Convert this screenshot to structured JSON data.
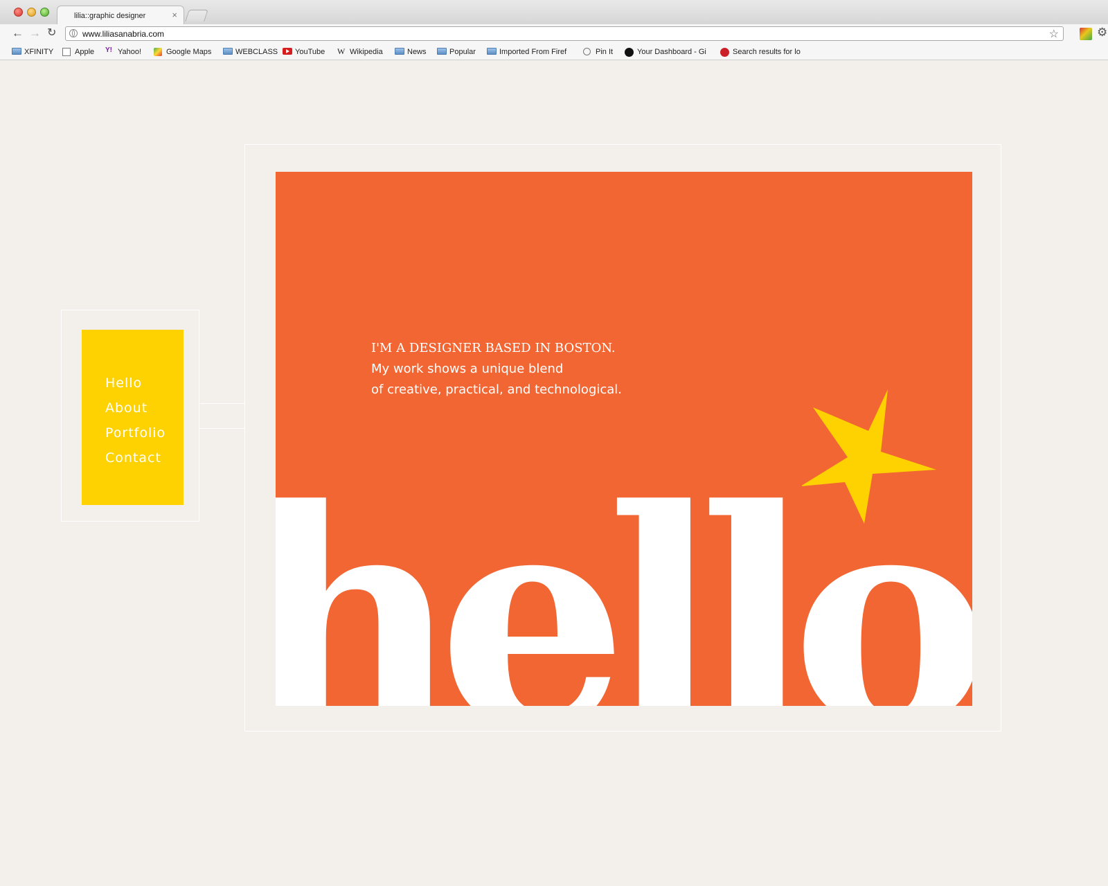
{
  "browser": {
    "tab_title": "lilia::graphic designer",
    "tab_close": "×",
    "url": "www.liliasanabria.com",
    "nav": {
      "back": "←",
      "forward": "→",
      "reload": "↻",
      "star": "☆",
      "wrench": "🔧"
    },
    "bookmarks": [
      {
        "label": "XFINITY",
        "icon": "folder-icon"
      },
      {
        "label": "Apple",
        "icon": "page-icon"
      },
      {
        "label": "Yahoo!",
        "icon": "yahoo-icon",
        "glyph": "Y!"
      },
      {
        "label": "Google Maps",
        "icon": "maps-icon"
      },
      {
        "label": "WEBCLASS",
        "icon": "folder-icon"
      },
      {
        "label": "YouTube",
        "icon": "youtube-icon"
      },
      {
        "label": "Wikipedia",
        "icon": "wikipedia-icon",
        "glyph": "W"
      },
      {
        "label": "News",
        "icon": "folder-icon"
      },
      {
        "label": "Popular",
        "icon": "folder-icon"
      },
      {
        "label": "Imported From Firef",
        "icon": "folder-icon"
      },
      {
        "label": "Pin It",
        "icon": "globe-icon"
      },
      {
        "label": "Your Dashboard - Gi",
        "icon": "github-icon"
      },
      {
        "label": "Search results for lo",
        "icon": "pinterest-icon"
      }
    ]
  },
  "site": {
    "nav": [
      "Hello",
      "About",
      "Portfolio",
      "Contact"
    ],
    "intro": [
      "I'M A  DESIGNER BASED IN BOSTON.",
      "My work shows a unique blend",
      "of creative, practical, and technological."
    ],
    "hero_word": "hello!",
    "colors": {
      "background": "#f3f0eb",
      "hero": "#f26633",
      "nav_panel": "#fed100",
      "star": "#fed100",
      "text": "#ffffff"
    }
  }
}
